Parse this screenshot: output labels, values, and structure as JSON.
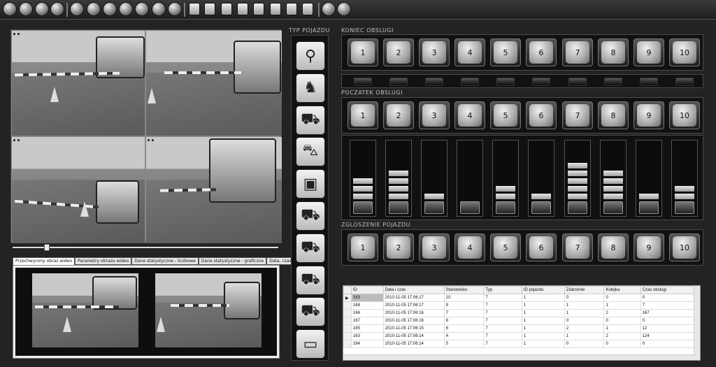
{
  "labels": {
    "typ_pojazdu": "Typ pojazdu",
    "koniec_obslugi": "Koniec obslugi",
    "poczatek_obslugi": "Poczatek obslugi",
    "zgloszenie_pojazdu": "Zgloszenie pojazdu"
  },
  "tabs": [
    "Przechwycony obraz wideo",
    "Parametry obrazu wideo",
    "Dane statystyczne - liczbowe",
    "Dane statystyczne - graficzne",
    "Data, czas, kalendarz"
  ],
  "stations": [
    "1",
    "2",
    "3",
    "4",
    "5",
    "6",
    "7",
    "8",
    "9",
    "10"
  ],
  "levels": {
    "meter_segments": [
      3,
      4,
      1,
      0,
      2,
      1,
      5,
      4,
      1,
      2
    ]
  },
  "video": {
    "slider_position": 0.12
  },
  "vehicle_types": [
    "bicycle-icon",
    "motorcycle-icon",
    "tractor-icon",
    "car-icon",
    "bus-icon",
    "van-icon",
    "truck-icon",
    "semi-truck-icon",
    "dump-truck-icon",
    "trailer-icon"
  ],
  "grid": {
    "columns": [
      "ID",
      "Data i czas",
      "Stanowisko",
      "Typ",
      "ID pojazdu",
      "Zdarzenie",
      "Kolejka",
      "Czas obslugi"
    ],
    "rows": [
      [
        "163",
        "2010-11-05 17:06:17",
        "10",
        "7",
        "1",
        "0",
        "0",
        "0"
      ],
      [
        "168",
        "2010-11-05 17:06:17",
        "9",
        "7",
        "1",
        "1",
        "1",
        "7"
      ],
      [
        "166",
        "2010-11-05 17:06:16",
        "7",
        "7",
        "1",
        "1",
        "2",
        "167"
      ],
      [
        "167",
        "2010-11-05 17:06:16",
        "8",
        "7",
        "1",
        "0",
        "0",
        "0"
      ],
      [
        "165",
        "2010-11-05 17:06:15",
        "6",
        "7",
        "1",
        "2",
        "1",
        "12"
      ],
      [
        "163",
        "2010-11-05 17:06:14",
        "4",
        "7",
        "1",
        "1",
        "2",
        "124"
      ],
      [
        "164",
        "2010-11-05 17:06:14",
        "5",
        "7",
        "1",
        "0",
        "0",
        "0"
      ]
    ]
  }
}
